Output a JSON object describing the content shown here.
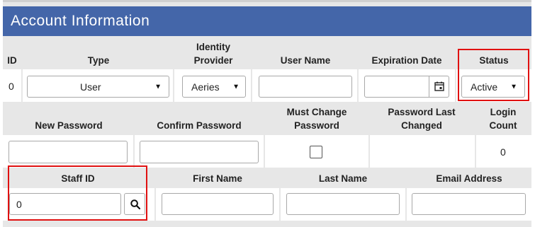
{
  "panel": {
    "title": "Account Information"
  },
  "row1": {
    "headers": {
      "id": "ID",
      "type": "Type",
      "identity_provider": "Identity Provider",
      "user_name": "User Name",
      "expiration_date": "Expiration Date",
      "status": "Status"
    },
    "values": {
      "id": "0",
      "type": "User",
      "identity_provider": "Aeries",
      "user_name": "",
      "expiration_date": "",
      "status": "Active"
    }
  },
  "row2": {
    "headers": {
      "new_password": "New Password",
      "confirm_password": "Confirm Password",
      "must_change_password": "Must Change Password",
      "password_last_changed": "Password Last Changed",
      "login_count": "Login Count"
    },
    "values": {
      "new_password": "",
      "confirm_password": "",
      "must_change_password": false,
      "password_last_changed": "",
      "login_count": "0"
    }
  },
  "row3": {
    "headers": {
      "staff_id": "Staff ID",
      "first_name": "First Name",
      "last_name": "Last Name",
      "email_address": "Email Address"
    },
    "values": {
      "staff_id": "0",
      "first_name": "",
      "last_name": "",
      "email_address": ""
    }
  },
  "icons": {
    "dropdown": "chevron-down-icon",
    "calendar": "calendar-icon",
    "search": "search-icon"
  },
  "colors": {
    "title_bar": "#4466a9",
    "highlight": "#e01010",
    "grid_background": "#e7e7e7"
  }
}
